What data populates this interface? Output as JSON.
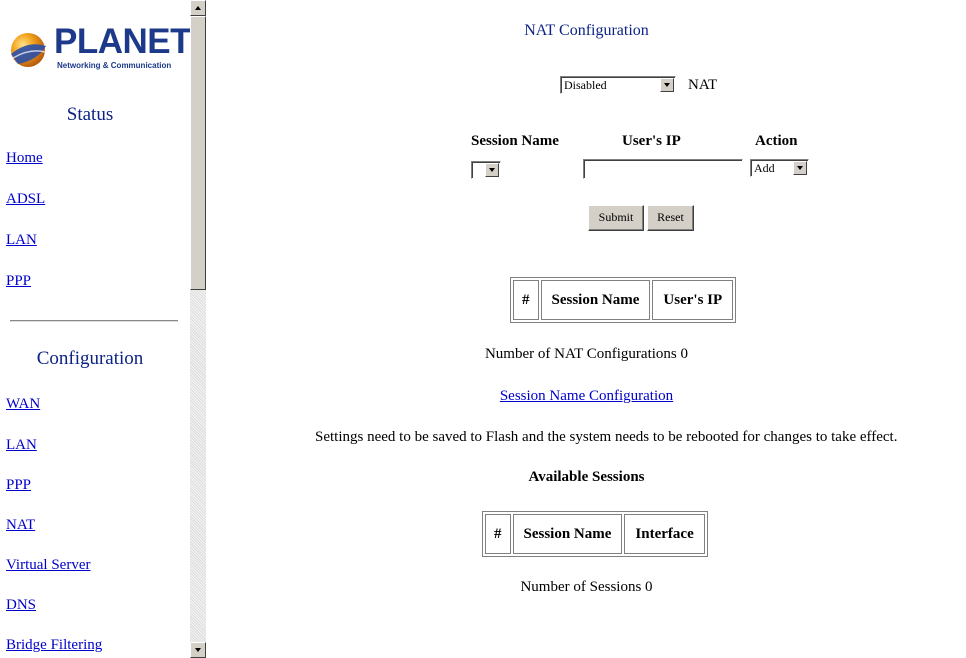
{
  "nav": {
    "logo_text": "PLANET",
    "logo_tagline": "Networking & Communication",
    "status_heading": "Status",
    "status_links": [
      "Home",
      "ADSL",
      "LAN",
      "PPP"
    ],
    "config_heading": "Configuration",
    "config_links": [
      "WAN",
      "LAN",
      "PPP",
      "NAT",
      "Virtual Server",
      "DNS",
      "Bridge Filtering"
    ]
  },
  "main": {
    "title": "NAT Configuration",
    "nat_select_value": "Disabled",
    "nat_label": "NAT",
    "headers": {
      "session_name": "Session Name",
      "users_ip": "User's IP",
      "action": "Action"
    },
    "session_select_value": "",
    "users_ip_value": "",
    "action_select_value": "Add",
    "submit_label": "Submit",
    "reset_label": "Reset",
    "nat_table": {
      "columns": [
        "#",
        "Session Name",
        "User's IP"
      ],
      "rows": []
    },
    "nat_count_text": "Number of NAT Configurations 0",
    "session_config_link": "Session Name Configuration",
    "notice": "Settings need to be saved to Flash and the system needs to be rebooted for changes to take effect.",
    "available_heading": "Available Sessions",
    "sessions_table": {
      "columns": [
        "#",
        "Session Name",
        "Interface"
      ],
      "rows": []
    },
    "sessions_count_text": "Number of Sessions 0"
  },
  "colors": {
    "heading_blue": "#0c2385",
    "link_blue": "#0000cc",
    "logo_blue": "#1d3a8a",
    "button_face": "#d4d0c8"
  }
}
